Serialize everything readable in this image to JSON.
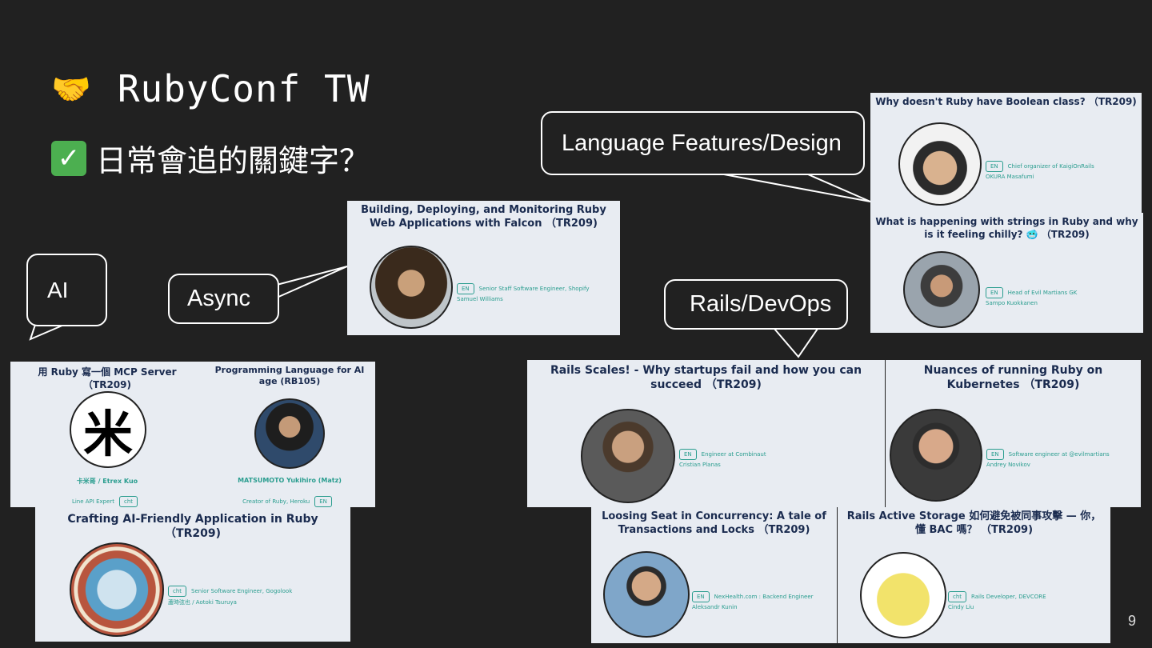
{
  "slide": {
    "title": "RubyConf TW",
    "title_icon": "handshake-icon",
    "subtitle": "日常會追的關鍵字？",
    "subtitle_icon": "check-icon",
    "page_number": "9"
  },
  "bubbles": {
    "ai": "AI",
    "async": "Async",
    "language": "Language Features/Design",
    "rails": "Rails/DevOps"
  },
  "cards": {
    "falcon": {
      "title": "Building, Deploying, and Monitoring Ruby Web Applications with Falcon （TR209)",
      "lang": "EN",
      "role": "Senior Staff Software Engineer, Shopify",
      "speaker": "Samuel Williams"
    },
    "boolean": {
      "title": "Why doesn't Ruby have Boolean class? （TR209)",
      "lang": "EN",
      "role": "Chief organizer of KaigiOnRails",
      "speaker": "OKURA Masafumi"
    },
    "strings": {
      "title": "What is happening with strings in Ruby and why is it feeling chilly? 🥶 （TR209)",
      "lang": "EN",
      "role": "Head of Evil Martians GK",
      "speaker": "Sampo Kuokkanen"
    },
    "mcp": {
      "title": "用 Ruby 寫一個 MCP Server （TR209)",
      "speaker": "卡米哥 / Etrex Kuo",
      "role": "Line API Expert",
      "lang": "cht",
      "avatar_glyph": "米"
    },
    "ailang": {
      "title": "Programming Language for AI age (RB105)",
      "speaker": "MATSUMOTO Yukihiro (Matz)",
      "role": "Creator of Ruby, Heroku",
      "lang": "EN"
    },
    "crafting": {
      "title": "Crafting AI-Friendly Application in Ruby （TR209)",
      "lang": "cht",
      "role": "Senior Software Engineer, Gogolook",
      "speaker": "蘆時弦也 / Aotoki Tsuruya"
    },
    "railsscales": {
      "title": "Rails Scales! - Why startups fail and how you can succeed （TR209)",
      "lang": "EN",
      "role": "Engineer at Combinaut",
      "speaker": "Cristian Planas"
    },
    "k8s": {
      "title": "Nuances of running Ruby on Kubernetes （TR209)",
      "lang": "EN",
      "role": "Software engineer at @evilmartians",
      "speaker": "Andrey Novikov"
    },
    "concurrency": {
      "title": "Loosing Seat in Concurrency: A tale of Transactions and Locks （TR209)",
      "lang": "EN",
      "role": "NexHealth.com : Backend Engineer",
      "speaker": "Aleksandr Kunin"
    },
    "storage": {
      "title": "Rails Active Storage 如何避免被同事攻擊 — 你，懂 BAC 嗎？ （TR209)",
      "lang": "cht",
      "role": "Rails Developer, DEVCORE",
      "speaker": "Cindy Liu"
    }
  }
}
